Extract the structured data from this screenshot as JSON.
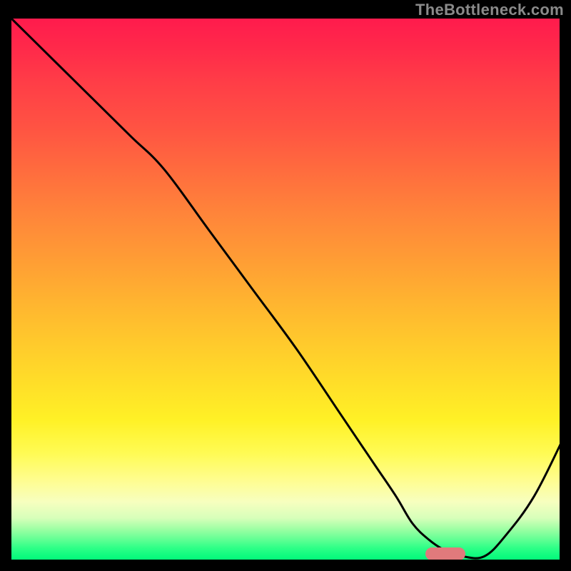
{
  "watermark": "TheBottleneck.com",
  "chart_data": {
    "type": "line",
    "title": "",
    "xlabel": "",
    "ylabel": "",
    "xlim": [
      0,
      100
    ],
    "ylim": [
      0,
      100
    ],
    "series": [
      {
        "name": "bottleneck-curve",
        "x": [
          0,
          8,
          15,
          22,
          28,
          36,
          44,
          52,
          60,
          66,
          70,
          73,
          76,
          79,
          82,
          86,
          90,
          95,
          100
        ],
        "y": [
          100,
          92,
          85,
          78,
          72,
          61,
          50,
          39,
          27,
          18,
          12,
          7,
          4,
          2,
          1,
          1,
          5,
          12,
          22
        ]
      }
    ],
    "optimum_marker": {
      "x": 79,
      "y": 1.5
    },
    "gradient_colors": {
      "top": "#ff1a4d",
      "mid": "#ffe028",
      "bottom": "#00f778"
    }
  }
}
